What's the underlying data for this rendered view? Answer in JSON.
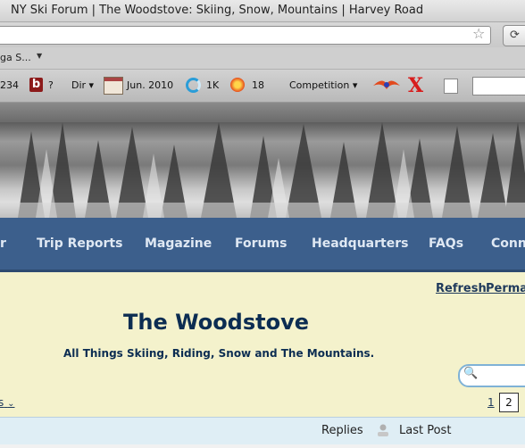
{
  "window": {
    "title": "NY Ski Forum | The Woodstove: Skiing, Snow, Mountains | Harvey Road"
  },
  "bookmarks": {
    "first": "ga S...",
    "arrow": "▼"
  },
  "toolbar": {
    "num1": "234",
    "b_label": "?",
    "dir_label": "Dir ▾",
    "date_label": "Jun. 2010",
    "count_label": "1K",
    "num2": "18",
    "competition_label": "Competition ▾"
  },
  "nav": {
    "items": [
      "r",
      "Trip Reports",
      "Magazine",
      "Forums",
      "Headquarters",
      "FAQs",
      "Conn"
    ]
  },
  "forum": {
    "refresh": "Refresh",
    "permalink": "Permal",
    "title": "The Woodstove",
    "subtitle": "All Things Skiing, Riding, Snow and The Mountains.",
    "left_link": "s",
    "pages": [
      "1",
      "2"
    ]
  },
  "table": {
    "replies": "Replies",
    "last_post": "Last Post"
  },
  "icons": [
    "star-icon",
    "b-icon",
    "calendar-icon",
    "ring-icon",
    "sun-icon",
    "bird-icon",
    "x-icon",
    "note-icon",
    "search-icon",
    "user-icon"
  ]
}
